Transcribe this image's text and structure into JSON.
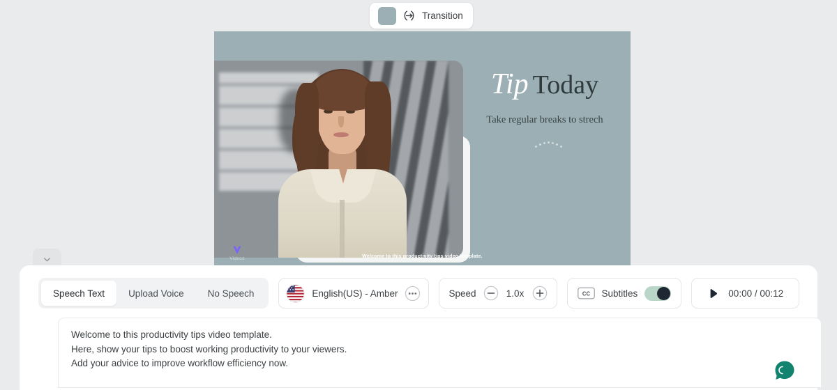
{
  "transition": {
    "label": "Transition",
    "icon": "transition-icon",
    "swatch_color": "#9bafb4"
  },
  "slide": {
    "background_color": "#9bafb4",
    "title_italic": "Tip",
    "title_rest": "Today",
    "subtitle": "Take regular breaks to strech",
    "caption": "Welcome to this productivity tips video template.",
    "watermark": "Vidnoz"
  },
  "collapse": {
    "icon": "chevron-down-icon"
  },
  "toolbar": {
    "tabs": [
      {
        "label": "Speech Text",
        "active": true
      },
      {
        "label": "Upload Voice",
        "active": false
      },
      {
        "label": "No Speech",
        "active": false
      }
    ],
    "voice": {
      "flag": "us-flag-icon",
      "name": "English(US) - Amber",
      "more": "more-options-icon"
    },
    "speed": {
      "label": "Speed",
      "value": "1.0x",
      "decrease": "minus-circle-icon",
      "increase": "plus-circle-icon"
    },
    "subtitles": {
      "icon": "cc-icon",
      "label": "Subtitles",
      "enabled": true,
      "track_color": "#b9d6c9",
      "knob_color": "#1f2733"
    },
    "player": {
      "play": "play-icon",
      "time": "00:00 / 00:12"
    }
  },
  "script": {
    "lines": [
      "Welcome to this productivity tips video template.",
      "Here, show your tips to boost working productivity to your viewers.",
      "Add your advice to improve workflow efficiency now."
    ]
  },
  "support": {
    "icon": "chat-bubble-icon",
    "color": "#12836e"
  }
}
